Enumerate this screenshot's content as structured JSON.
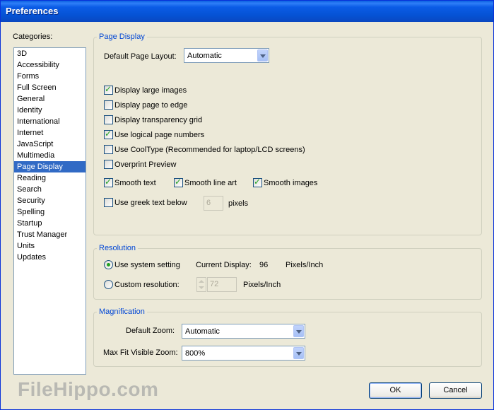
{
  "window": {
    "title": "Preferences"
  },
  "categories": {
    "label": "Categories:",
    "items": [
      "3D",
      "Accessibility",
      "Forms",
      "Full Screen",
      "General",
      "Identity",
      "International",
      "Internet",
      "JavaScript",
      "Multimedia",
      "Page Display",
      "Reading",
      "Search",
      "Security",
      "Spelling",
      "Startup",
      "Trust Manager",
      "Units",
      "Updates"
    ],
    "selected": "Page Display"
  },
  "page_display": {
    "title": "Page Display",
    "layout_label": "Default Page Layout:",
    "layout_value": "Automatic",
    "checkboxes": {
      "large_images": {
        "label": "Display large images",
        "checked": true
      },
      "page_to_edge": {
        "label": "Display page to edge",
        "checked": false
      },
      "transparency_grid": {
        "label": "Display transparency grid",
        "checked": false
      },
      "logical_numbers": {
        "label": "Use logical page numbers",
        "checked": true
      },
      "cooltype": {
        "label": "Use CoolType (Recommended for laptop/LCD screens)",
        "checked": false
      },
      "overprint": {
        "label": "Overprint Preview",
        "checked": false
      },
      "smooth_text": {
        "label": "Smooth text",
        "checked": true
      },
      "smooth_line_art": {
        "label": "Smooth line art",
        "checked": true
      },
      "smooth_images": {
        "label": "Smooth images",
        "checked": true
      },
      "greek_text": {
        "label": "Use greek text below",
        "checked": false
      }
    },
    "greek_value": "6",
    "greek_unit": "pixels"
  },
  "resolution": {
    "title": "Resolution",
    "system_label": "Use system setting",
    "system_selected": true,
    "current_label": "Current Display:",
    "current_value": "96",
    "current_unit": "Pixels/Inch",
    "custom_label": "Custom resolution:",
    "custom_value": "72",
    "custom_unit": "Pixels/Inch"
  },
  "magnification": {
    "title": "Magnification",
    "zoom_label": "Default Zoom:",
    "zoom_value": "Automatic",
    "maxfit_label": "Max Fit Visible Zoom:",
    "maxfit_value": "800%"
  },
  "buttons": {
    "ok": "OK",
    "cancel": "Cancel"
  },
  "watermark": "FileHippo.com",
  "colors": {
    "accent": "#0046d5",
    "selection": "#316ac5",
    "titlebar": "#0b5ce6"
  }
}
